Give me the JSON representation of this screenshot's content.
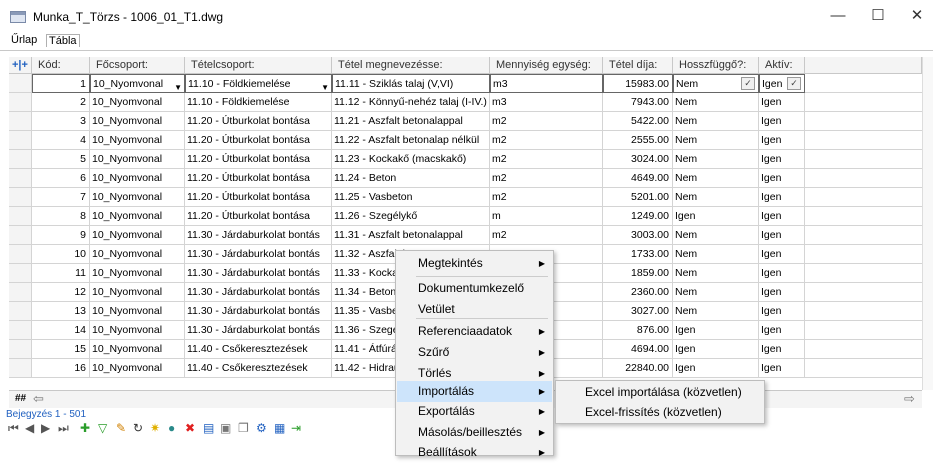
{
  "window": {
    "title": "Munka_T_Törzs - 1006_01_T1.dwg",
    "minimize": "—",
    "maximize": "☐",
    "close": "✕"
  },
  "tabs": [
    {
      "label": "Űrlap"
    },
    {
      "label": "Tábla"
    }
  ],
  "columns": [
    {
      "label": "Kód:"
    },
    {
      "label": "Főcsoport:"
    },
    {
      "label": "Tételcsoport:"
    },
    {
      "label": "Tétel megnevezésse:"
    },
    {
      "label": "Mennyiség egység:"
    },
    {
      "label": "Tétel díja:"
    },
    {
      "label": "Hosszfüggő?:"
    },
    {
      "label": "Aktív:"
    }
  ],
  "rows": [
    {
      "kod": "1",
      "focs": "10_Nyomvonal",
      "tcs": "11.10 - Földkiemelése",
      "nev": "11.11 - Sziklás talaj (V,VI)",
      "me": "m3",
      "dij": "15983.00",
      "hossz": "Nem",
      "aktiv": "Igen"
    },
    {
      "kod": "2",
      "focs": "10_Nyomvonal",
      "tcs": "11.10 - Földkiemelése",
      "nev": "11.12 - Könnyű-nehéz talaj (I-IV.)",
      "me": "m3",
      "dij": "7943.00",
      "hossz": "Nem",
      "aktiv": "Igen"
    },
    {
      "kod": "3",
      "focs": "10_Nyomvonal",
      "tcs": "11.20 - Útburkolat bontása",
      "nev": "11.21 - Aszfalt betonalappal",
      "me": "m2",
      "dij": "5422.00",
      "hossz": "Nem",
      "aktiv": "Igen"
    },
    {
      "kod": "4",
      "focs": "10_Nyomvonal",
      "tcs": "11.20 - Útburkolat bontása",
      "nev": "11.22 - Aszfalt betonalap nélkül",
      "me": "m2",
      "dij": "2555.00",
      "hossz": "Nem",
      "aktiv": "Igen"
    },
    {
      "kod": "5",
      "focs": "10_Nyomvonal",
      "tcs": "11.20 - Útburkolat bontása",
      "nev": "11.23 - Kockakő  (macskakő)",
      "me": "m2",
      "dij": "3024.00",
      "hossz": "Nem",
      "aktiv": "Igen"
    },
    {
      "kod": "6",
      "focs": "10_Nyomvonal",
      "tcs": "11.20 - Útburkolat bontása",
      "nev": "11.24 - Beton",
      "me": "m2",
      "dij": "4649.00",
      "hossz": "Nem",
      "aktiv": "Igen"
    },
    {
      "kod": "7",
      "focs": "10_Nyomvonal",
      "tcs": "11.20 - Útburkolat bontása",
      "nev": "11.25 - Vasbeton",
      "me": "m2",
      "dij": "5201.00",
      "hossz": "Nem",
      "aktiv": "Igen"
    },
    {
      "kod": "8",
      "focs": "10_Nyomvonal",
      "tcs": "11.20 - Útburkolat bontása",
      "nev": "11.26 - Szegélykő",
      "me": "m",
      "dij": "1249.00",
      "hossz": "Igen",
      "aktiv": "Igen"
    },
    {
      "kod": "9",
      "focs": "10_Nyomvonal",
      "tcs": "11.30 - Járdaburkolat bontás",
      "nev": "11.31 - Aszfalt betonalappal",
      "me": "m2",
      "dij": "3003.00",
      "hossz": "Nem",
      "aktiv": "Igen"
    },
    {
      "kod": "10",
      "focs": "10_Nyomvonal",
      "tcs": "11.30 - Járdaburkolat bontás",
      "nev": "11.32 - Aszfalt b",
      "me": "",
      "dij": "1733.00",
      "hossz": "Nem",
      "aktiv": "Igen"
    },
    {
      "kod": "11",
      "focs": "10_Nyomvonal",
      "tcs": "11.30 - Járdaburkolat bontás",
      "nev": "11.33 - Kockakő betonlap ( dísz",
      "me": "",
      "dij": "1859.00",
      "hossz": "Nem",
      "aktiv": "Igen"
    },
    {
      "kod": "12",
      "focs": "10_Nyomvonal",
      "tcs": "11.30 - Járdaburkolat bontás",
      "nev": "11.34 - Beton",
      "me": "",
      "dij": "2360.00",
      "hossz": "Nem",
      "aktiv": "Igen"
    },
    {
      "kod": "13",
      "focs": "10_Nyomvonal",
      "tcs": "11.30 - Járdaburkolat bontás",
      "nev": "11.35 - Vasbeto",
      "me": "",
      "dij": "3027.00",
      "hossz": "Nem",
      "aktiv": "Igen"
    },
    {
      "kod": "14",
      "focs": "10_Nyomvonal",
      "tcs": "11.30 - Járdaburkolat bontás",
      "nev": "11.36 - Szegély",
      "me": "",
      "dij": "876.00",
      "hossz": "Igen",
      "aktiv": "Igen"
    },
    {
      "kod": "15",
      "focs": "10_Nyomvonal",
      "tcs": "11.40 - Csőkeresztezések",
      "nev": "11.41 - Átfúrás csigafúróval/ra",
      "me": "",
      "dij": "4694.00",
      "hossz": "Igen",
      "aktiv": "Igen"
    },
    {
      "kod": "16",
      "focs": "10_Nyomvonal",
      "tcs": "11.40 - Csőkeresztezések",
      "nev": "11.42 - Hidrauli",
      "me": "",
      "dij": "22840.00",
      "hossz": "Igen",
      "aktiv": "Igen"
    }
  ],
  "status": {
    "text": "Bejegyzés 1 - 501"
  },
  "hscroll": {
    "corner": "##"
  },
  "context_menu": [
    {
      "label": "Megtekintés",
      "has_sub": true
    },
    {
      "label": "Dokumentumkezelő",
      "has_sub": false
    },
    {
      "label": "Vetület",
      "has_sub": false
    },
    {
      "label": "Referenciaadatok",
      "has_sub": true
    },
    {
      "label": "Szűrő",
      "has_sub": true
    },
    {
      "label": "Törlés",
      "has_sub": true
    },
    {
      "label": "Importálás",
      "has_sub": true
    },
    {
      "label": "Exportálás",
      "has_sub": true
    },
    {
      "label": "Másolás/beillesztés",
      "has_sub": true
    },
    {
      "label": "Beállítások",
      "has_sub": true
    }
  ],
  "submenu": [
    {
      "label": "Excel importálása (közvetlen)"
    },
    {
      "label": "Excel-frissítés (közvetlen)"
    }
  ]
}
